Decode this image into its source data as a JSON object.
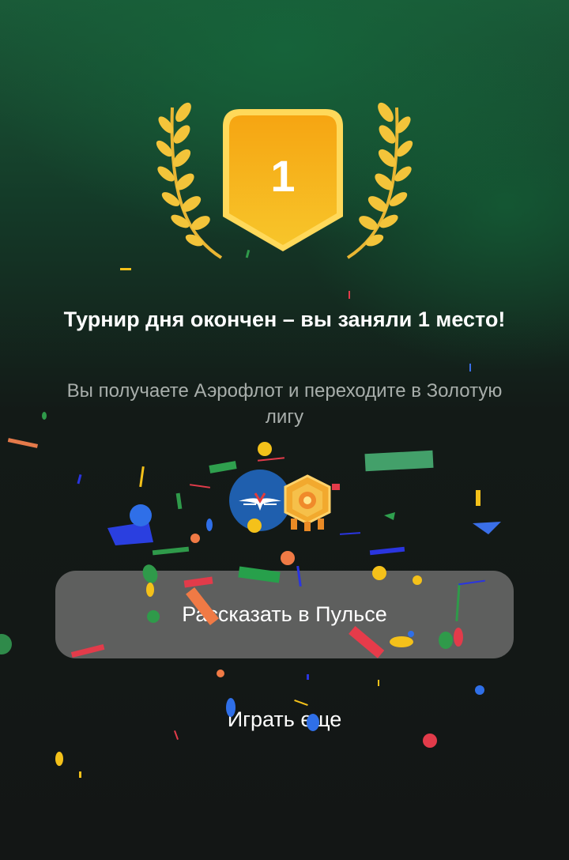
{
  "result": {
    "place": "1",
    "title": "Турнир дня окончен – вы заняли 1 место!",
    "subtitle": "Вы получаете Аэрофлот и переходите в Золотую лигу"
  },
  "rewards": [
    {
      "name": "aeroflot-logo"
    },
    {
      "name": "gold-league-badge"
    }
  ],
  "actions": {
    "share_label": "Рассказать в Пульсе",
    "play_again_label": "Играть еще"
  },
  "colors": {
    "medal_gold": "#f5b318",
    "laurel_gold": "#f2c33a",
    "button_bg": "#5e5f5e",
    "aeroflot_blue": "#1f5fae"
  }
}
